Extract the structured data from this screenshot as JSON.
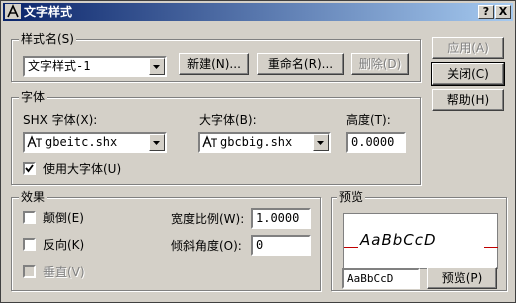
{
  "window": {
    "title": "文字样式",
    "help_button": "?",
    "close_button": "X"
  },
  "style_name": {
    "group_label": "样式名(S)",
    "selected": "文字样式-1",
    "new_button": "新建(N)...",
    "rename_button": "重命名(R)...",
    "delete_button": "删除(D)"
  },
  "side_buttons": {
    "apply": "应用(A)",
    "close": "关闭(C)",
    "help": "帮助(H)"
  },
  "font": {
    "group_label": "字体",
    "shx_label": "SHX 字体(X):",
    "shx_value": "gbeitc.shx",
    "big_label": "大字体(B):",
    "big_value": "gbcbig.shx",
    "height_label": "高度(T):",
    "height_value": "0.0000",
    "use_big_font_label": "使用大字体(U)",
    "use_big_font_checked": true
  },
  "effects": {
    "group_label": "效果",
    "upside_down_label": "颠倒(E)",
    "upside_down_checked": false,
    "backwards_label": "反向(K)",
    "backwards_checked": false,
    "vertical_label": "垂直(V)",
    "vertical_checked": false,
    "width_factor_label": "宽度比例(W):",
    "width_factor_value": "1.0000",
    "oblique_label": "倾斜角度(O):",
    "oblique_value": "0"
  },
  "preview": {
    "group_label": "预览",
    "sample_text": "AaBbCcD",
    "input_value": "AaBbCcD",
    "preview_button": "预览(P)"
  },
  "icons": {
    "title": "autocad-text-style-icon",
    "font": "shx-font-icon"
  },
  "colors": {
    "title_start": "#0a246a",
    "title_end": "#a6caf0",
    "baseline": "#c00000",
    "face": "#d4d0c8"
  }
}
